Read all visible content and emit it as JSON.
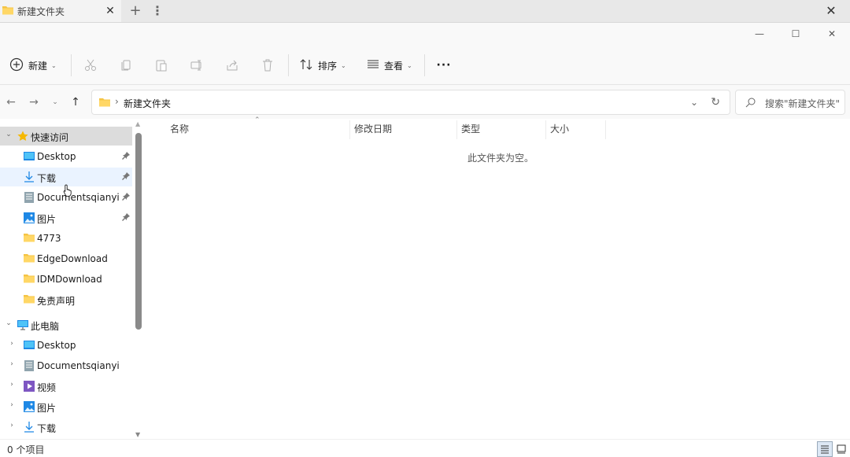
{
  "tab": {
    "title": "新建文件夹"
  },
  "toolbar": {
    "new_label": "新建",
    "sort_label": "排序",
    "view_label": "查看"
  },
  "address": {
    "path": "新建文件夹",
    "search_placeholder": "搜索\"新建文件夹\""
  },
  "sidebar": {
    "quick_access": {
      "label": "快速访问",
      "items": [
        {
          "label": "Desktop",
          "icon": "desktop-icon",
          "pinned": true
        },
        {
          "label": "下载",
          "icon": "download-icon",
          "pinned": true
        },
        {
          "label": "Documentsqianyi",
          "icon": "documents-icon",
          "pinned": true
        },
        {
          "label": "图片",
          "icon": "pictures-icon",
          "pinned": true
        },
        {
          "label": "4773",
          "icon": "folder-icon",
          "pinned": false
        },
        {
          "label": "EdgeDownload",
          "icon": "folder-icon",
          "pinned": false
        },
        {
          "label": "IDMDownload",
          "icon": "folder-icon",
          "pinned": false
        },
        {
          "label": "免责声明",
          "icon": "folder-icon",
          "pinned": false
        }
      ]
    },
    "this_pc": {
      "label": "此电脑",
      "items": [
        {
          "label": "Desktop",
          "icon": "desktop-icon"
        },
        {
          "label": "Documentsqianyi",
          "icon": "documents-icon"
        },
        {
          "label": "视频",
          "icon": "videos-icon"
        },
        {
          "label": "图片",
          "icon": "pictures-icon"
        },
        {
          "label": "下载",
          "icon": "download-icon"
        }
      ]
    }
  },
  "columns": {
    "name": "名称",
    "modified": "修改日期",
    "type": "类型",
    "size": "大小"
  },
  "empty_message": "此文件夹为空。",
  "status": {
    "item_count": "0 个项目"
  },
  "colors": {
    "folder": "#f5c445",
    "accent": "#0067c0",
    "selection": "#dcdcdc"
  }
}
